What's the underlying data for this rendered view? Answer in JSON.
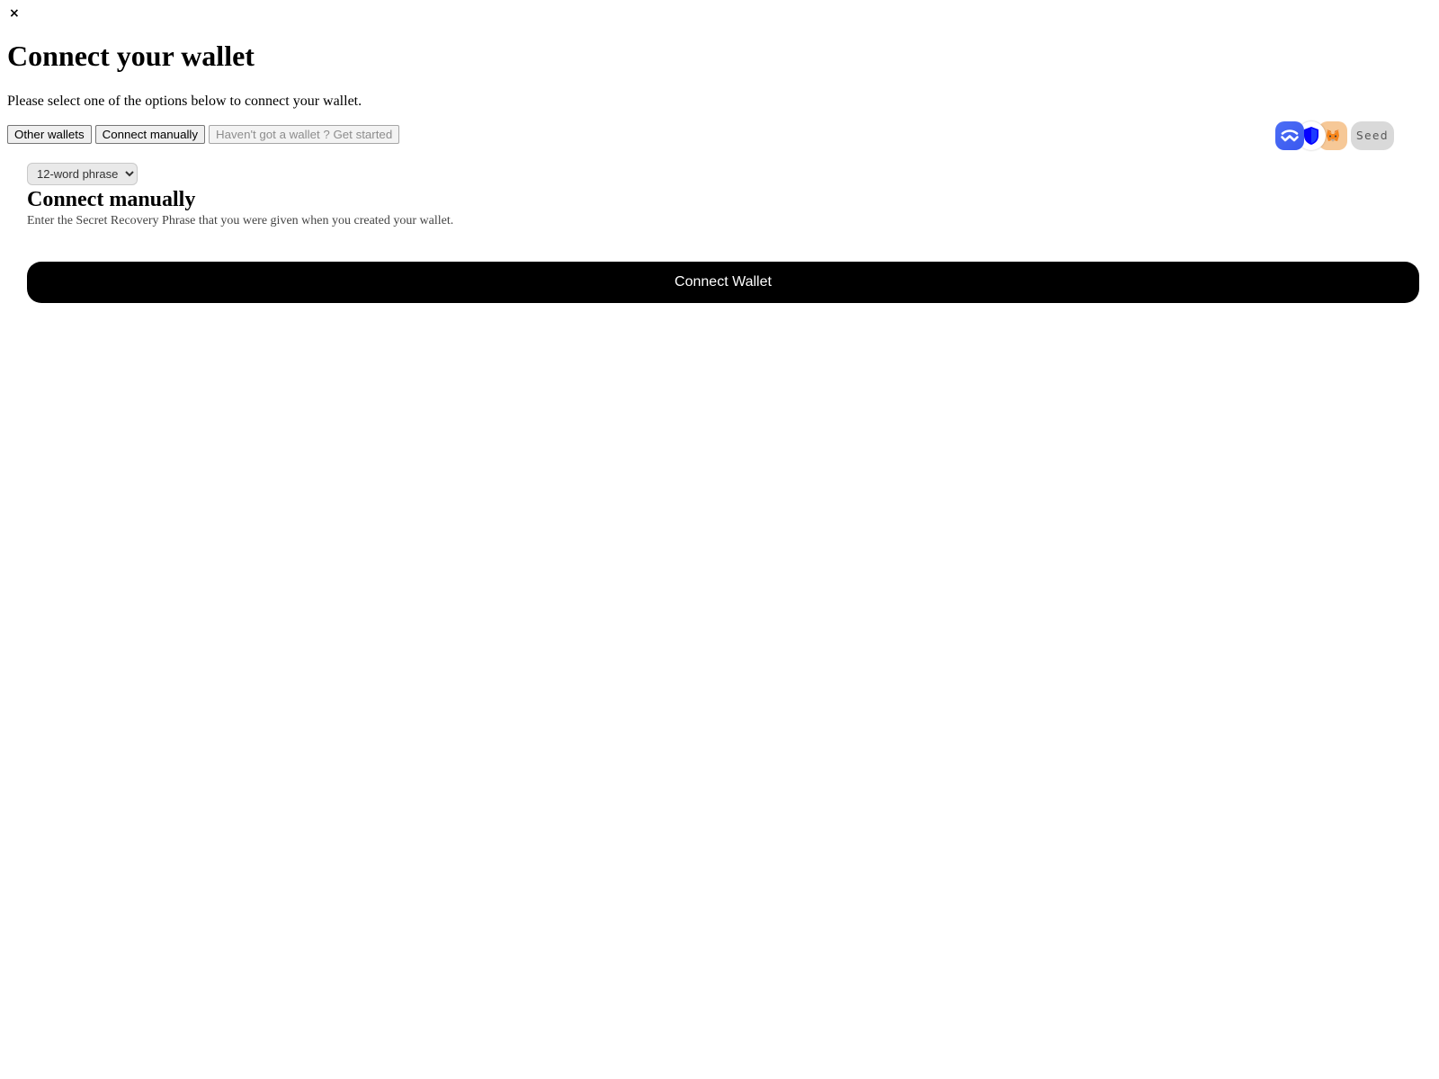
{
  "dialog": {
    "close_label": "×",
    "title": "Connect your wallet",
    "subtitle": "Please select one of the options below to connect your wallet."
  },
  "tabs": [
    {
      "label": "Other wallets",
      "disabled": false
    },
    {
      "label": "Connect manually",
      "disabled": false
    },
    {
      "label": "Haven't got a wallet ? Get started",
      "disabled": true
    }
  ],
  "wallet_badges": {
    "icons": [
      "walletconnect-icon",
      "trust-wallet-icon",
      "metamask-icon"
    ],
    "seed_label": "Seed"
  },
  "manual": {
    "phrase_select": {
      "selected": "12-word phrase"
    },
    "title": "Connect manually",
    "description": "Enter the Secret Recovery Phrase that you were given when you created your wallet.",
    "submit_label": "Connect Wallet"
  },
  "colors": {
    "primary_button_bg": "#000000",
    "primary_button_text": "#ffffff",
    "walletconnect_blue": "#3b5bf5",
    "seed_badge_bg": "#d9d9d9"
  }
}
